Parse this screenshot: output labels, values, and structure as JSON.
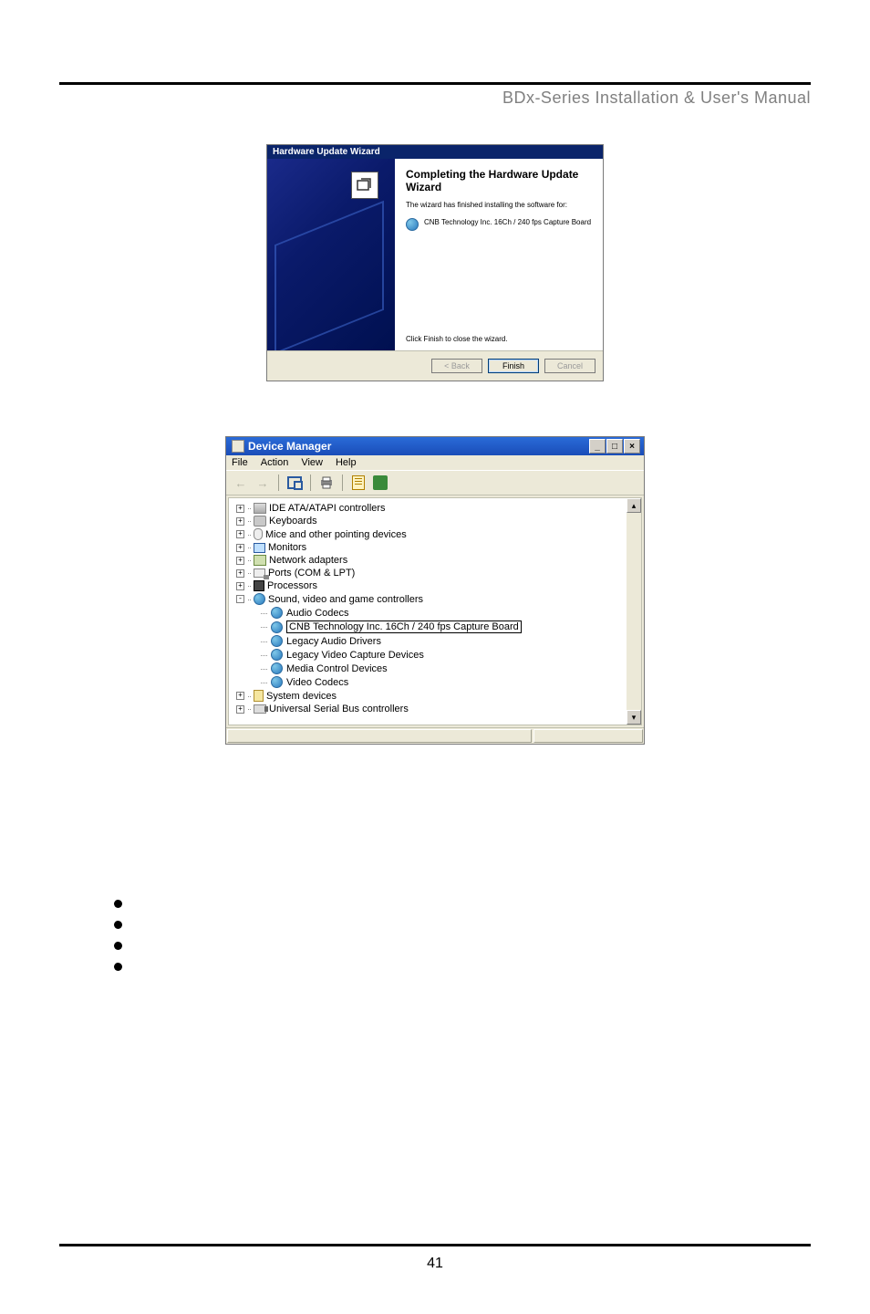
{
  "header": {
    "title": "BDx-Series Installation & User's Manual"
  },
  "wizard": {
    "titlebar": "Hardware Update Wizard",
    "heading": "Completing the Hardware Update Wizard",
    "finished_text": "The wizard has finished installing the software for:",
    "device_name": "CNB Technology Inc. 16Ch / 240 fps Capture Board",
    "close_text": "Click Finish to close the wizard.",
    "buttons": {
      "back": "< Back",
      "finish": "Finish",
      "cancel": "Cancel"
    }
  },
  "device_manager": {
    "title": "Device Manager",
    "menu": [
      "File",
      "Action",
      "View",
      "Help"
    ],
    "tree": {
      "collapsed": [
        {
          "icon": "ide",
          "label": "IDE ATA/ATAPI controllers"
        },
        {
          "icon": "keyboard",
          "label": "Keyboards"
        },
        {
          "icon": "mouse",
          "label": "Mice and other pointing devices"
        },
        {
          "icon": "monitor",
          "label": "Monitors"
        },
        {
          "icon": "net",
          "label": "Network adapters"
        },
        {
          "icon": "port",
          "label": "Ports (COM & LPT)"
        },
        {
          "icon": "cpu",
          "label": "Processors"
        }
      ],
      "expanded": {
        "icon": "av",
        "label": "Sound, video and game controllers",
        "children": [
          {
            "label": "Audio Codecs",
            "selected": false
          },
          {
            "label": "CNB Technology Inc. 16Ch / 240 fps Capture Board",
            "selected": true
          },
          {
            "label": "Legacy Audio Drivers",
            "selected": false
          },
          {
            "label": "Legacy Video Capture Devices",
            "selected": false
          },
          {
            "label": "Media Control Devices",
            "selected": false
          },
          {
            "label": "Video Codecs",
            "selected": false
          }
        ]
      },
      "collapsed_after": [
        {
          "icon": "sys",
          "label": "System devices"
        },
        {
          "icon": "usb",
          "label": "Universal Serial Bus controllers"
        }
      ]
    }
  },
  "footer": {
    "page_number": "41"
  }
}
